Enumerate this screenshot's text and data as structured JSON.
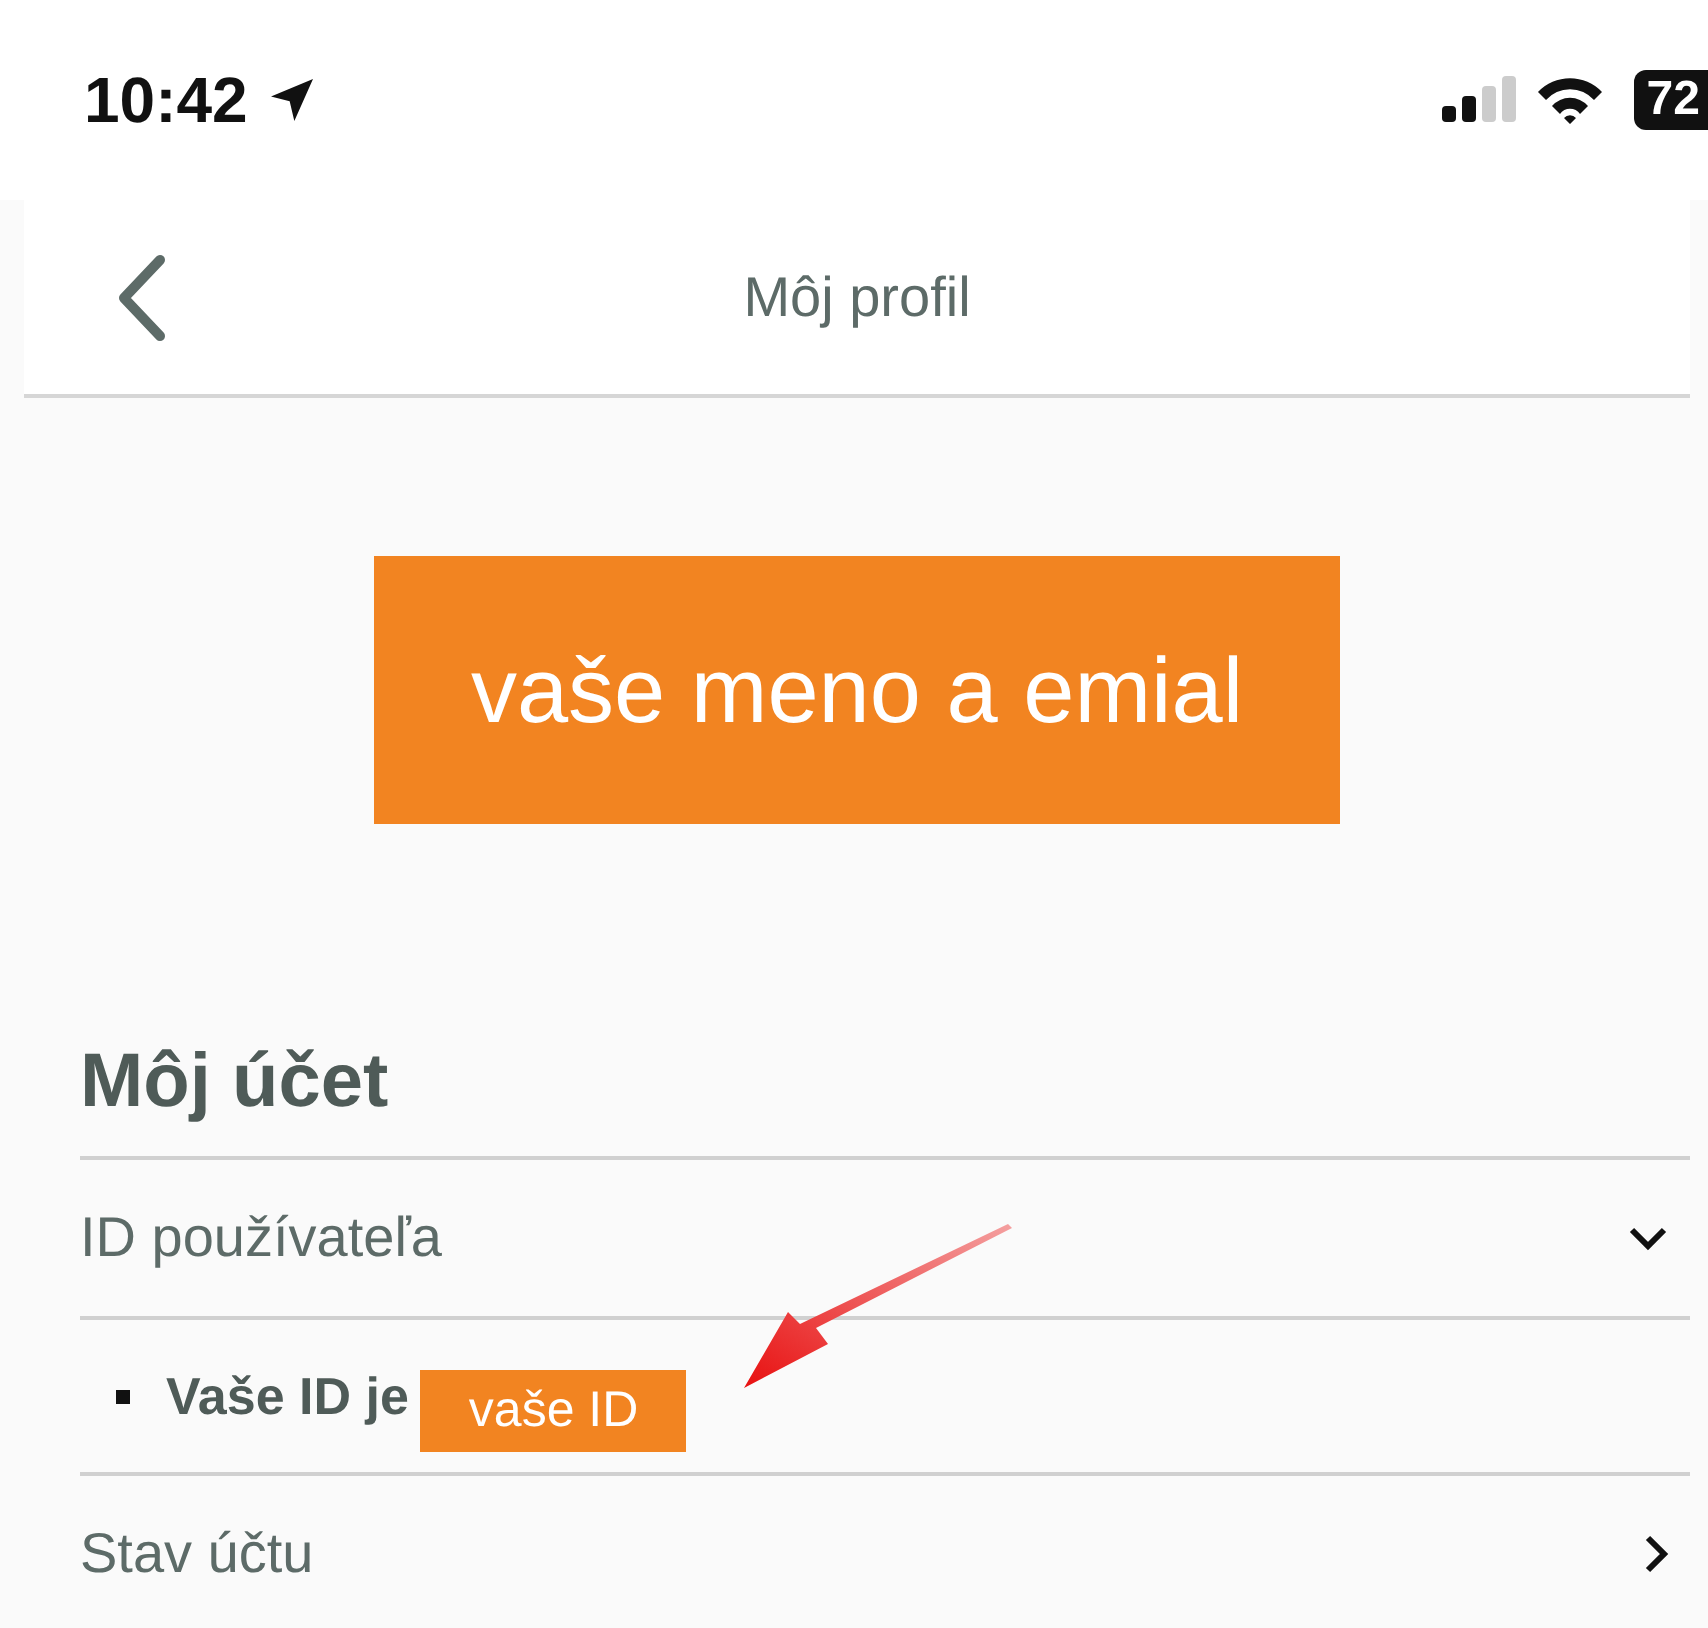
{
  "status_bar": {
    "time": "10:42",
    "battery": "72"
  },
  "nav": {
    "title": "Môj profil"
  },
  "annotation_banner": {
    "text": "vaše meno a emial"
  },
  "section": {
    "title": "Môj účet",
    "rows": [
      {
        "label": "ID používateľa",
        "expanded": true,
        "children": [
          {
            "label": "Vaše ID je",
            "annotation": "vaše ID"
          }
        ]
      },
      {
        "label": "Stav účtu",
        "expanded": false
      }
    ]
  }
}
